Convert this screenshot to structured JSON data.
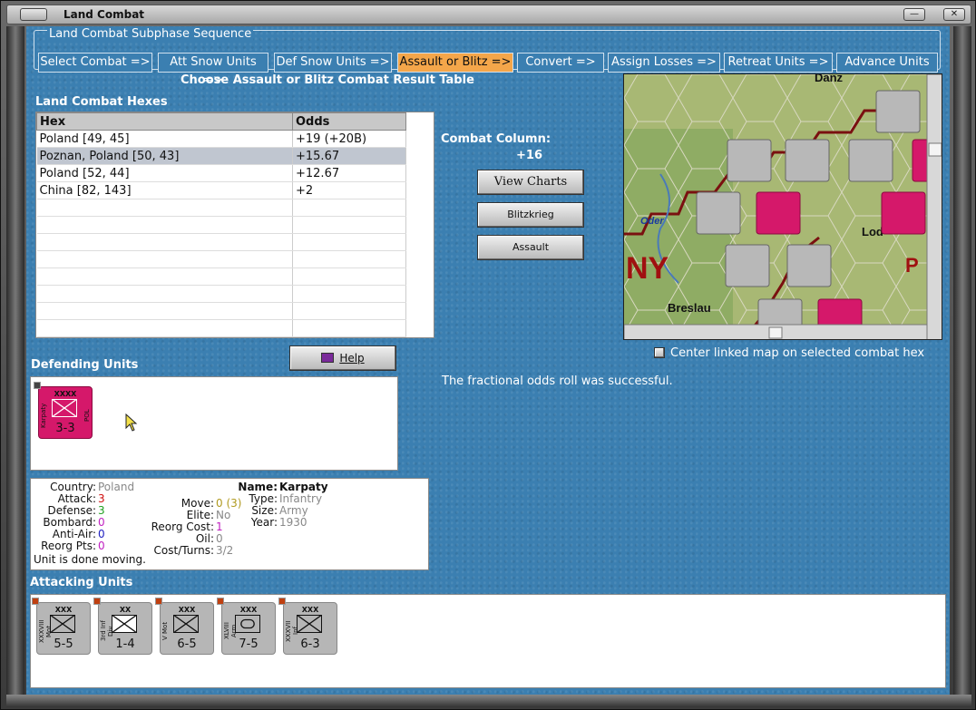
{
  "window": {
    "title": "Land Combat",
    "buttons": [
      "—",
      "▢",
      "✕"
    ]
  },
  "phases": {
    "legend": "Land Combat Subphase Sequence",
    "tabs": [
      "Select Combat =>",
      "Att Snow Units =>",
      "Def Snow Units =>",
      "Assault or Blitz =>",
      "Convert =>",
      "Assign Losses =>",
      "Retreat Units =>",
      "Advance Units"
    ],
    "active": 3
  },
  "prompt": "Choose Assault or Blitz Combat Result Table",
  "hexes": {
    "heading": "Land Combat Hexes",
    "columns": [
      "Hex",
      "Odds"
    ],
    "rows": [
      {
        "hex": "Poland [49, 45]",
        "odds": "+19 (+20B)"
      },
      {
        "hex": "Poznan, Poland [50, 43]",
        "odds": "+15.67"
      },
      {
        "hex": "Poland [52, 44]",
        "odds": "+12.67"
      },
      {
        "hex": "China [82, 143]",
        "odds": "+2"
      }
    ],
    "selected_row": 1
  },
  "combat": {
    "column_label": "Combat Column:",
    "column_value": "+16",
    "view_charts": "View Charts",
    "blitzkrieg": "Blitzkrieg",
    "assault": "Assault"
  },
  "help_button": "Help",
  "map": {
    "labels": [
      "Danz",
      "Oder",
      "NY",
      "Lod",
      "P",
      "Breslau"
    ],
    "center_checkbox": {
      "label": "Center linked map on selected combat hex",
      "checked": false
    }
  },
  "message": "The fractional odds roll was successful.",
  "defending": {
    "heading": "Defending Units",
    "units": [
      {
        "size": "XXXX",
        "side": "Karpaty",
        "nation": "POL",
        "strength": "3-3",
        "color": "#d5186a"
      }
    ]
  },
  "unit_info": {
    "country_label": "Country:",
    "country": "Poland",
    "attack_label": "Attack:",
    "attack": "3",
    "defense_label": "Defense:",
    "defense": "3",
    "bombard_label": "Bombard:",
    "bombard": "0",
    "antiair_label": "Anti-Air:",
    "antiair": "0",
    "reorg_pts_label": "Reorg Pts:",
    "reorg_pts": "0",
    "name_label": "Name:",
    "name": "Karpaty",
    "move_label": "Move:",
    "move": "0 (3)",
    "elite_label": "Elite:",
    "elite": "No",
    "reorg_cost_label": "Reorg Cost:",
    "reorg_cost": "1",
    "oil_label": "Oil:",
    "oil": "0",
    "cost_turns_label": "Cost/Turns:",
    "cost_turns": "3/2",
    "type_label": "Type:",
    "type": "Infantry",
    "size_label": "Size:",
    "size": "Army",
    "year_label": "Year:",
    "year": "1930",
    "status": "Unit is done moving."
  },
  "attacking": {
    "heading": "Attacking Units",
    "units": [
      {
        "size": "XXX",
        "side": "XXXVIII Mot",
        "strength": "5-5",
        "kind": "motorized"
      },
      {
        "size": "XX",
        "side": "3rd Inf Div",
        "strength": "1-4",
        "kind": "infantry"
      },
      {
        "size": "XXX",
        "side": "V Mot",
        "strength": "6-5",
        "kind": "motorized"
      },
      {
        "size": "XXX",
        "side": "XLVIII Arm",
        "strength": "7-5",
        "kind": "armor"
      },
      {
        "size": "XXX",
        "side": "XXXVII Inf",
        "strength": "6-3",
        "kind": "infantry"
      }
    ]
  },
  "colors": {
    "background": "#3b7fb1",
    "active_tab": "#f4a64a",
    "polish_unit": "#d5186a",
    "german_unit": "#b6b6b6"
  }
}
